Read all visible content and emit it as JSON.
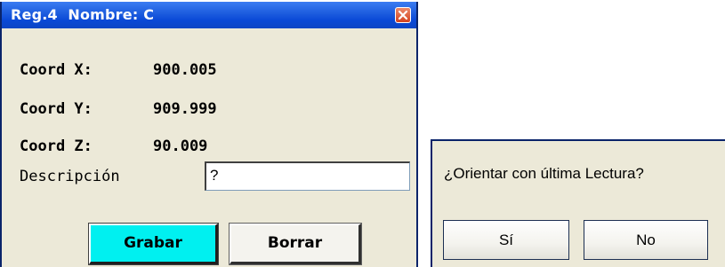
{
  "register_dialog": {
    "title": "Reg.4  Nombre: C",
    "coords": [
      {
        "label": "Coord X:",
        "value": "900.005"
      },
      {
        "label": "Coord Y:",
        "value": "909.999"
      },
      {
        "label": "Coord Z:",
        "value": "90.009"
      }
    ],
    "description_label": "Descripción",
    "description_value": "?",
    "buttons": {
      "save_label": "Grabar",
      "delete_label": "Borrar"
    },
    "colors": {
      "titlebar": "#0a49d6",
      "save_button": "#00f0f0",
      "window_body": "#ece9d8"
    },
    "close_icon": "close-icon"
  },
  "confirm_dialog": {
    "question": "¿Orientar con última Lectura?",
    "yes_label": "Sí",
    "no_label": "No"
  }
}
